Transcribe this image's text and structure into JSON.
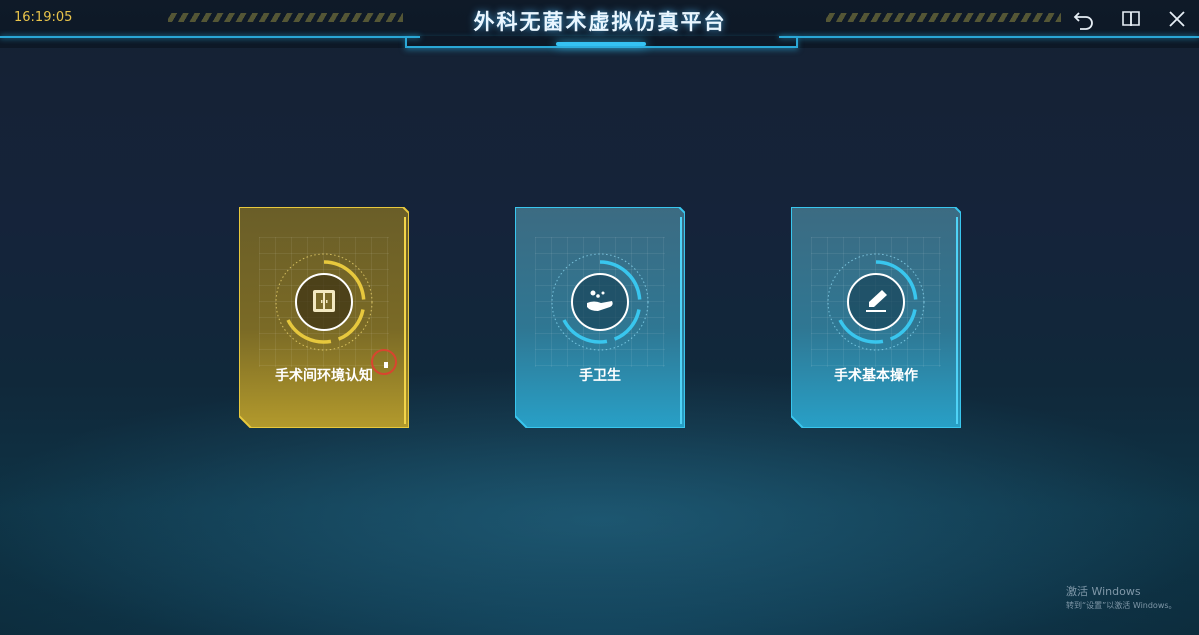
{
  "header": {
    "time": "16:19:05",
    "title": "外科无菌术虚拟仿真平台",
    "buttons": [
      {
        "name": "back",
        "icon": "undo-icon"
      },
      {
        "name": "manual",
        "icon": "book-icon"
      },
      {
        "name": "close",
        "icon": "close-icon"
      }
    ]
  },
  "modules": [
    {
      "label": "手术间环境认知",
      "icon": "door-icon",
      "selected": true,
      "color": "#d7bb3c"
    },
    {
      "label": "手卫生",
      "icon": "hand-wash-icon",
      "selected": false,
      "color": "#39c6ee"
    },
    {
      "label": "手术基本操作",
      "icon": "scalpel-icon",
      "selected": false,
      "color": "#39c6ee"
    }
  ],
  "watermark": {
    "line1": "激活 Windows",
    "line2": "转到“设置”以激活 Windows。"
  }
}
